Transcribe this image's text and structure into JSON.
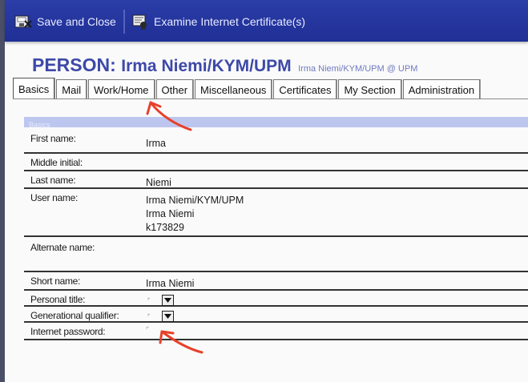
{
  "toolbar": {
    "save_close_label": "Save and Close",
    "examine_cert_label": "Examine Internet Certificate(s)"
  },
  "header": {
    "type_label": "PERSON:",
    "name": "Irma Niemi/KYM/UPM",
    "subtitle": "Irma Niemi/KYM/UPM @ UPM"
  },
  "tabs": [
    {
      "label": "Basics",
      "active": true
    },
    {
      "label": "Mail"
    },
    {
      "label": "Work/Home"
    },
    {
      "label": "Other"
    },
    {
      "label": "Miscellaneous"
    },
    {
      "label": "Certificates"
    },
    {
      "label": "My Section"
    },
    {
      "label": "Administration"
    }
  ],
  "section": {
    "title": "Basics"
  },
  "fields": {
    "first_name": {
      "label": "First name:",
      "value": "Irma"
    },
    "middle_initial": {
      "label": "Middle initial:",
      "value": ""
    },
    "last_name": {
      "label": "Last name:",
      "value": "Niemi"
    },
    "user_name": {
      "label": "User name:",
      "values": [
        "Irma Niemi/KYM/UPM",
        "Irma Niemi",
        "k173829"
      ]
    },
    "alternate_name": {
      "label": "Alternate name:",
      "value": ""
    },
    "short_name": {
      "label": "Short name:",
      "value": "Irma Niemi"
    },
    "personal_title": {
      "label": "Personal title:",
      "value": ""
    },
    "generational_qualifier": {
      "label": "Generational qualifier:",
      "value": ""
    },
    "internet_password": {
      "label": "Internet password:",
      "value": ""
    }
  },
  "icons": {
    "save_close": "save-close-icon",
    "examine_cert": "certificate-icon",
    "dropdown": "chevron-down-icon",
    "annotation": "red-arrow"
  },
  "colors": {
    "toolbar_bg": "#2435a0",
    "heading": "#3d49a8",
    "section_bar": "#bdc6ee",
    "annotation_arrow": "#e8402a"
  }
}
